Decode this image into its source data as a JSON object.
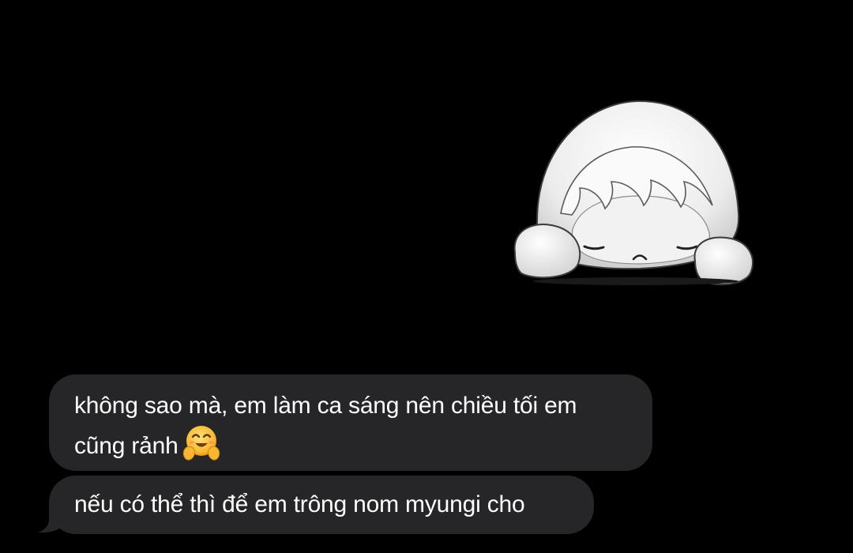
{
  "sticker": {
    "icon": "sad-white-fluffy-creature-sticker"
  },
  "messages": [
    {
      "line1": "không sao mà, em làm ca sáng nên chiều tối em",
      "line2": "cũng rảnh",
      "emoji": "hugging-face-emoji"
    },
    {
      "line1": "nếu có thể thì để em trông nom myungi cho"
    }
  ],
  "colors": {
    "background": "#000000",
    "bubble": "#262628",
    "text": "#ffffff"
  }
}
